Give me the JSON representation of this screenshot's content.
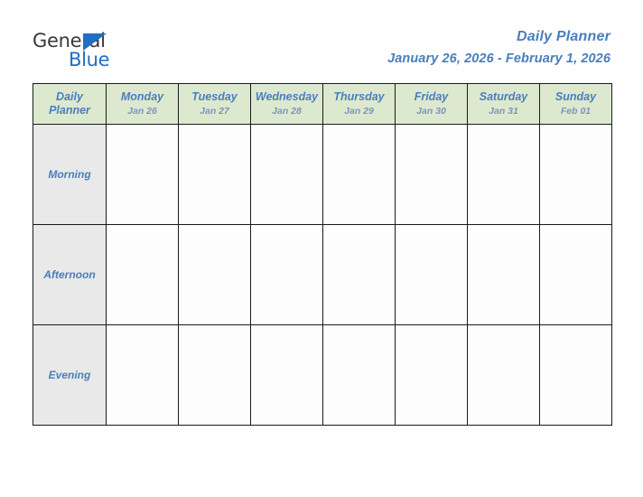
{
  "brand": {
    "name_dark": "General",
    "name_blue": "Blue",
    "triangle_icon": "triangle-right-icon",
    "accent_color": "#1f6fc4"
  },
  "header": {
    "title": "Daily Planner",
    "date_range": "January 26, 2026 - February 1, 2026",
    "title_color": "#4a7ebc"
  },
  "table": {
    "corner_label_line1": "Daily",
    "corner_label_line2": "Planner",
    "header_bg": "#dde9cf",
    "row_label_bg": "#e9e9e9",
    "border_color": "#1a1a1a",
    "columns": [
      {
        "day": "Monday",
        "date": "Jan 26"
      },
      {
        "day": "Tuesday",
        "date": "Jan 27"
      },
      {
        "day": "Wednesday",
        "date": "Jan 28"
      },
      {
        "day": "Thursday",
        "date": "Jan 29"
      },
      {
        "day": "Friday",
        "date": "Jan 30"
      },
      {
        "day": "Saturday",
        "date": "Jan 31"
      },
      {
        "day": "Sunday",
        "date": "Feb 01"
      }
    ],
    "rows": [
      {
        "label": "Morning",
        "cells": [
          "",
          "",
          "",
          "",
          "",
          "",
          ""
        ]
      },
      {
        "label": "Afternoon",
        "cells": [
          "",
          "",
          "",
          "",
          "",
          "",
          ""
        ]
      },
      {
        "label": "Evening",
        "cells": [
          "",
          "",
          "",
          "",
          "",
          "",
          ""
        ]
      }
    ]
  }
}
